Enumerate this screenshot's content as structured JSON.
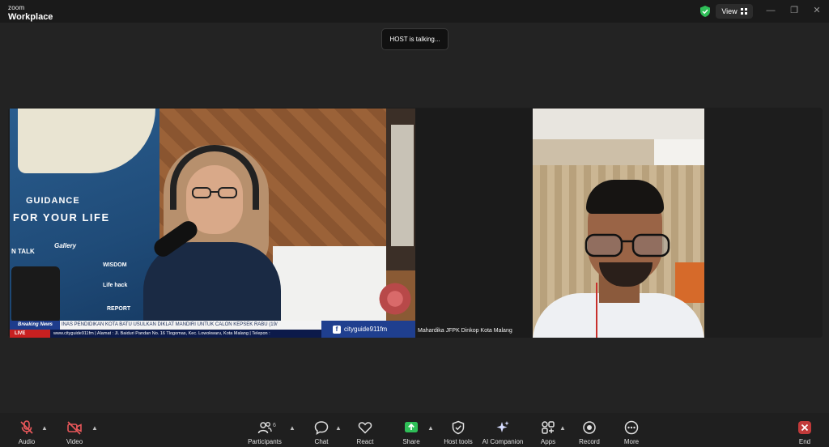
{
  "app": {
    "brand_small": "zoom",
    "brand_big": "Workplace"
  },
  "titlebar": {
    "view_label": "View"
  },
  "toast": "HOST is talking...",
  "host_video": {
    "overlay_guidance": "GUIDANCE",
    "overlay_tagline": "FOR YOUR LIFE",
    "sticker_talk": "N TALK",
    "sticker_gallery": "Gallery",
    "sticker_wisdom": "WISDOM",
    "sticker_lifehack": "Life hack",
    "sticker_report": "REPORT",
    "breaking_label": "Breaking News",
    "ticker_top": "INAS PENDIDIKAN KOTA BATU USULKAN DIKLAT MANDIRI UNTUK CALON KEPSEK    RABU (19/",
    "live_label": "LIVE",
    "ticker_bottom": "www.cityguide911fm | Alamat : Jl. Baiduri Pandan No. 16 Tlogomas, Kec. Lowokwaru, Kota Malang | Telepon :",
    "social_handle": "cityguide911fm"
  },
  "participant_name": "Mahardika JFPK Dinkop Kota Malang",
  "toolbar": {
    "audio": "Audio",
    "video": "Video",
    "participants": "Participants",
    "participants_count": "6",
    "chat": "Chat",
    "react": "React",
    "share": "Share",
    "host_tools": "Host tools",
    "ai_companion": "AI Companion",
    "apps": "Apps",
    "record": "Record",
    "more": "More",
    "end": "End"
  },
  "colors": {
    "accent_green": "#2fbf58",
    "end_red": "#c13a3a",
    "mic_off_red": "#e8575a",
    "background": "#232323"
  }
}
